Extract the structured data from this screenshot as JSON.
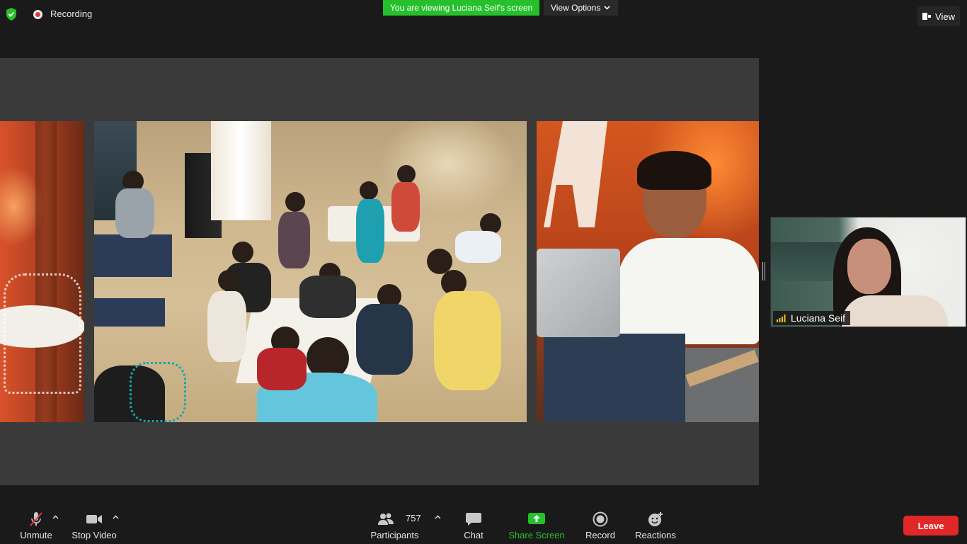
{
  "status": {
    "recording_label": "Recording"
  },
  "share_banner": {
    "viewing_text": "You are viewing Luciana Seif's screen",
    "view_options_label": "View Options"
  },
  "top_right": {
    "view_label": "View"
  },
  "video_tile": {
    "participant_name": "Luciana Seif"
  },
  "toolbar": {
    "unmute_label": "Unmute",
    "stop_video_label": "Stop Video",
    "participants_label": "Participants",
    "participants_count": "757",
    "chat_label": "Chat",
    "share_screen_label": "Share Screen",
    "record_label": "Record",
    "reactions_label": "Reactions",
    "leave_label": "Leave"
  },
  "colors": {
    "accent_green": "#25c02b",
    "leave_red": "#e02828",
    "background": "#1a1a1a",
    "share_bg": "#3a3a3a"
  },
  "icons": {
    "shield": "shield-check-icon",
    "recording": "record-dot-icon",
    "chevron": "chevron-down-icon",
    "view": "view-layout-icon",
    "mic_muted": "microphone-muted-icon",
    "video": "video-camera-icon",
    "participants": "participants-icon",
    "chat": "chat-bubble-icon",
    "share_screen": "share-screen-icon",
    "record": "record-icon",
    "reactions": "emoji-plus-icon",
    "caret_up": "caret-up-icon",
    "signal": "audio-signal-icon"
  }
}
